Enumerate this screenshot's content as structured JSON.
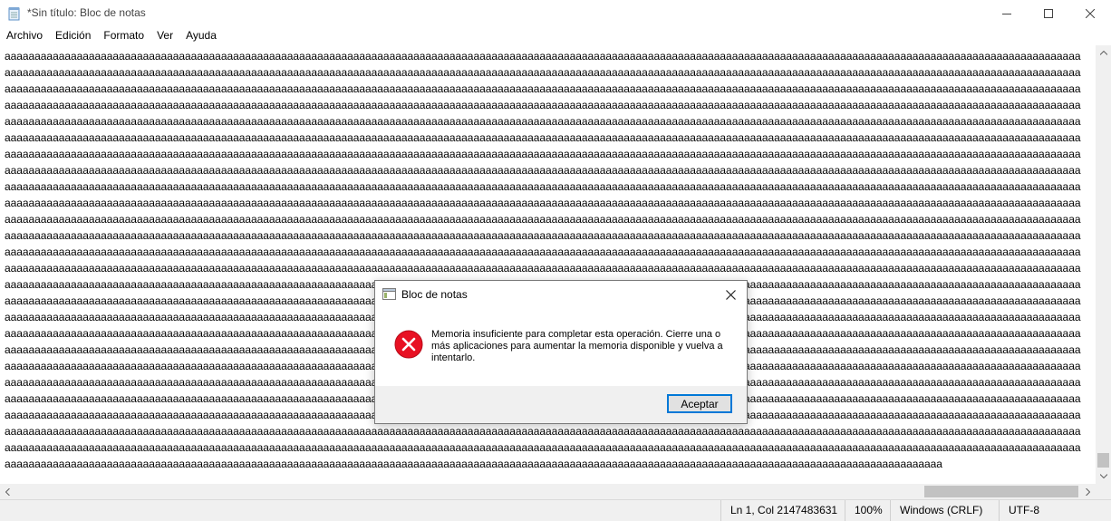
{
  "window": {
    "title": "*Sin título: Bloc de notas",
    "icon": "notepad-icon"
  },
  "menu": {
    "items": [
      "Archivo",
      "Edición",
      "Formato",
      "Ver",
      "Ayuda"
    ]
  },
  "editor": {
    "line_text": "aaaaaaaaaaaaaaaaaaaaaaaaaaaaaaaaaaaaaaaaaaaaaaaaaaaaaaaaaaaaaaaaaaaaaaaaaaaaaaaaaaaaaaaaaaaaaaaaaaaaaaaaaaaaaaaaaaaaaaaaaaaaaaaaaaaaaaaaaaaaaaaaaaaaaaaaaaaaaaaaaaaaaaaaaaaaaaaaaaa",
    "last_line_text": "aaaaaaaaaaaaaaaaaaaaaaaaaaaaaaaaaaaaaaaaaaaaaaaaaaaaaaaaaaaaaaaaaaaaaaaaaaaaaaaaaaaaaaaaaaaaaaaaaaaaaaaaaaaaaaaaaaaaaaaaaaaaaaaaaaaaaaaaaaaaaaaaaaaaaaaaaaaa",
    "line_count": 26
  },
  "status": {
    "position": "Ln 1, Col 2147483631",
    "zoom": "100%",
    "line_ending": "Windows (CRLF)",
    "encoding": "UTF-8"
  },
  "dialog": {
    "title": "Bloc de notas",
    "message": "Memoria insuficiente para completar esta operación. Cierre una o más aplicaciones para aumentar la memoria disponible y vuelva a intentarlo.",
    "ok_label": "Aceptar",
    "icon": "error-icon"
  },
  "colors": {
    "accent": "#0078d7",
    "error": "#e81123"
  }
}
